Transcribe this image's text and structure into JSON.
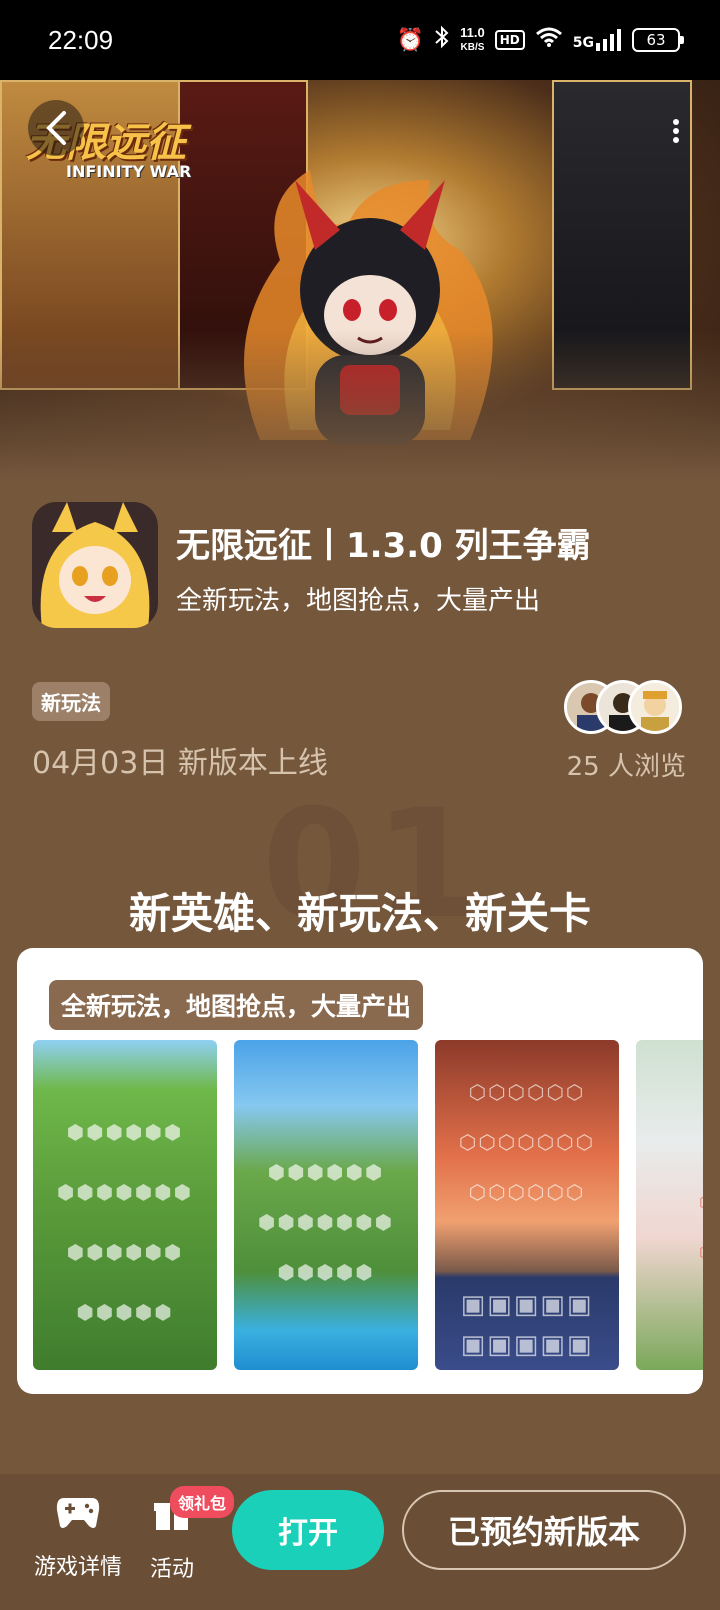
{
  "status_bar": {
    "time": "22:09",
    "net_speed_value": "11.0",
    "net_speed_unit": "KB/S",
    "hd": "HD",
    "signal": "5G",
    "battery": "63"
  },
  "banner": {
    "logo_text_cn": "无限远征",
    "logo_text_en": "INFINITY WAR"
  },
  "app": {
    "title": "无限远征丨1.3.0 列王争霸",
    "subtitle": "全新玩法，地图抢点，大量产出"
  },
  "update": {
    "tag": "新玩法",
    "date_line": "04月03日 新版本上线",
    "views": "25 人浏览"
  },
  "section": {
    "number": "01",
    "title": "新英雄、新玩法、新关卡",
    "card_caption": "全新玩法，地图抢点，大量产出"
  },
  "bottom_bar": {
    "game_detail_label": "游戏详情",
    "activity_label": "活动",
    "gift_badge": "领礼包",
    "open_button": "打开",
    "reserve_button": "已预约新版本"
  },
  "colors": {
    "page_bg": "#75573c",
    "open_button": "#1ad0b8",
    "gift_badge": "#ef4d5e",
    "bottom_bar": "#6a4e36"
  }
}
